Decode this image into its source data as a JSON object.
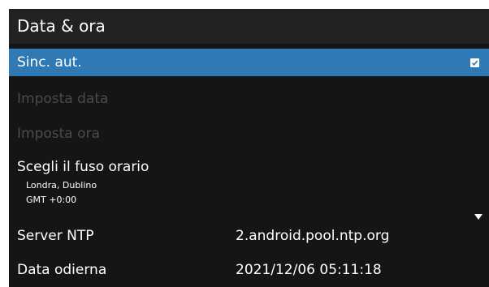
{
  "header": {
    "title": "Data & ora"
  },
  "items": {
    "auto_sync": {
      "label": "Sinc. aut.",
      "checked": true,
      "selected": true
    },
    "set_date": {
      "label": "Imposta data",
      "enabled": false
    },
    "set_time": {
      "label": "Imposta ora",
      "enabled": false
    },
    "timezone": {
      "label": "Scegli il fuso orario",
      "city": "Londra, Dublino",
      "offset": "GMT +0:00"
    },
    "ntp_server": {
      "label": "Server NTP",
      "value": "2.android.pool.ntp.org"
    },
    "current_date": {
      "label": "Data odierna",
      "value": "2021/12/06 05:11:18"
    }
  },
  "icons": {
    "checkbox": "check-icon",
    "scroll": "triangle-down-icon"
  },
  "colors": {
    "background": "#151515",
    "header": "#222222",
    "selection": "#2f7ab4",
    "disabled_text": "#4a4a4a"
  }
}
